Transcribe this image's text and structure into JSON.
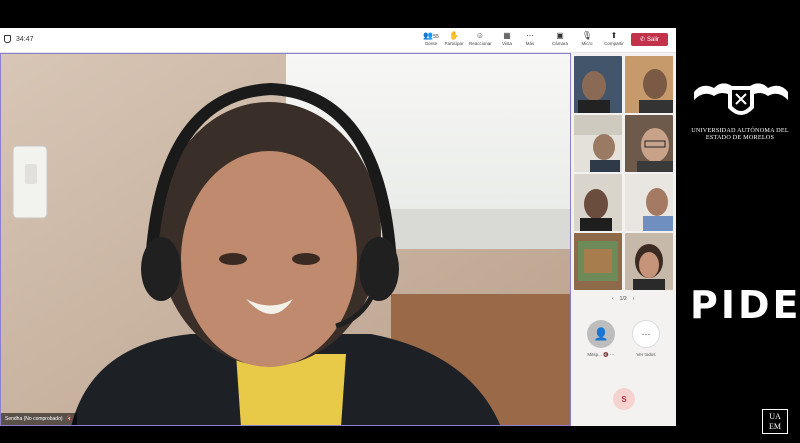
{
  "toolbar": {
    "timer": "34:47",
    "buttons": [
      {
        "count": "55",
        "label": "Gente",
        "icon": "people-icon"
      },
      {
        "label": "Participar",
        "icon": "raise-hand-icon"
      },
      {
        "label": "Reaccionar",
        "icon": "smile-icon"
      },
      {
        "label": "Vista",
        "icon": "grid-icon"
      },
      {
        "label": "Más",
        "icon": "more-icon"
      },
      {
        "label": "Cámara",
        "icon": "camera-icon"
      },
      {
        "label": "Micro",
        "icon": "mic-off-icon"
      },
      {
        "label": "Compartir",
        "icon": "share-icon"
      }
    ],
    "leave_label": "Salir",
    "leave_color": "#c4314b"
  },
  "main_video": {
    "name_label": "Sendha (No comprobado)"
  },
  "side_panel": {
    "pager": "1/2",
    "self_label": "Mitsp...",
    "view_all_label": "Ver todos",
    "self_initial": "S"
  },
  "branding": {
    "university_line1": "UNIVERSIDAD AUTÓNOMA DEL",
    "university_line2": "ESTADO DE MORELOS",
    "program": "PIDE",
    "badge_top": "UA",
    "badge_bottom": "EM"
  }
}
